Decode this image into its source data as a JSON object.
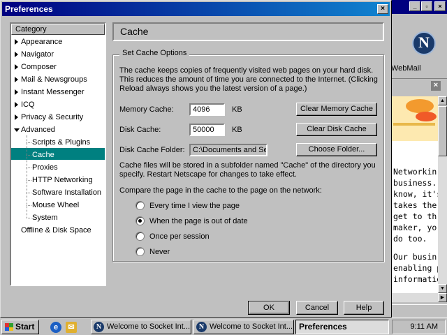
{
  "dialog": {
    "title": "Preferences",
    "close_glyph": "×",
    "category_header": "Category",
    "categories": [
      {
        "label": "Appearance"
      },
      {
        "label": "Navigator"
      },
      {
        "label": "Composer"
      },
      {
        "label": "Mail & Newsgroups"
      },
      {
        "label": "Instant Messenger"
      },
      {
        "label": "ICQ"
      },
      {
        "label": "Privacy & Security"
      },
      {
        "label": "Advanced"
      },
      {
        "label": "Scripts & Plugins"
      },
      {
        "label": "Cache"
      },
      {
        "label": "Proxies"
      },
      {
        "label": "HTTP Networking"
      },
      {
        "label": "Software Installation"
      },
      {
        "label": "Mouse Wheel"
      },
      {
        "label": "System"
      },
      {
        "label": "Offline & Disk Space"
      }
    ],
    "section_title": "Cache",
    "group_label": "Set Cache Options",
    "intro_lines": [
      "The cache keeps copies of frequently visited web pages on your hard disk.",
      "This reduces the amount of time you are connected to the Internet. (Clicking",
      "Reload always shows you the latest version of a page.)"
    ],
    "memory_cache": {
      "label": "Memory Cache:",
      "value": "4096",
      "unit": "KB",
      "button": "Clear Memory Cache"
    },
    "disk_cache": {
      "label": "Disk Cache:",
      "value": "50000",
      "unit": "KB",
      "button": "Clear Disk Cache"
    },
    "cache_folder": {
      "label": "Disk Cache Folder:",
      "value": "C:\\Documents and Se",
      "button": "Choose Folder..."
    },
    "folder_note_lines": [
      "Cache files will be stored in a subfolder named \"Cache\" of the directory you",
      "specify. Restart Netscape for changes to take effect."
    ],
    "compare_label": "Compare the page in the cache to the page on the network:",
    "compare_options": [
      {
        "label": "Every time I view the page",
        "selected": false
      },
      {
        "label": "When the page is out of date",
        "selected": true
      },
      {
        "label": "Once per session",
        "selected": false
      },
      {
        "label": "Never",
        "selected": false
      }
    ],
    "buttons": {
      "ok": "OK",
      "cancel": "Cancel",
      "help": "Help"
    }
  },
  "background_browser": {
    "min_glyph": "_",
    "max_glyph": "▫",
    "close_glyph": "×",
    "logo_letter": "N",
    "webmail_label": "WebMail",
    "text_lines": [
      "Networkin",
      "business.",
      "know, it's",
      "takes the",
      "get to th",
      "maker, yo",
      "do too.",
      "",
      "Our busin",
      "enabling p",
      "informatio"
    ]
  },
  "taskbar": {
    "start_label": "Start",
    "tasks": [
      {
        "label": "Welcome to Socket Int..."
      },
      {
        "label": "Welcome to Socket Int..."
      },
      {
        "label": "Preferences"
      }
    ],
    "clock": "9:11 AM"
  },
  "colors": {
    "title_bar": "#000080",
    "selection": "#008080",
    "face": "#c0c0c0"
  }
}
